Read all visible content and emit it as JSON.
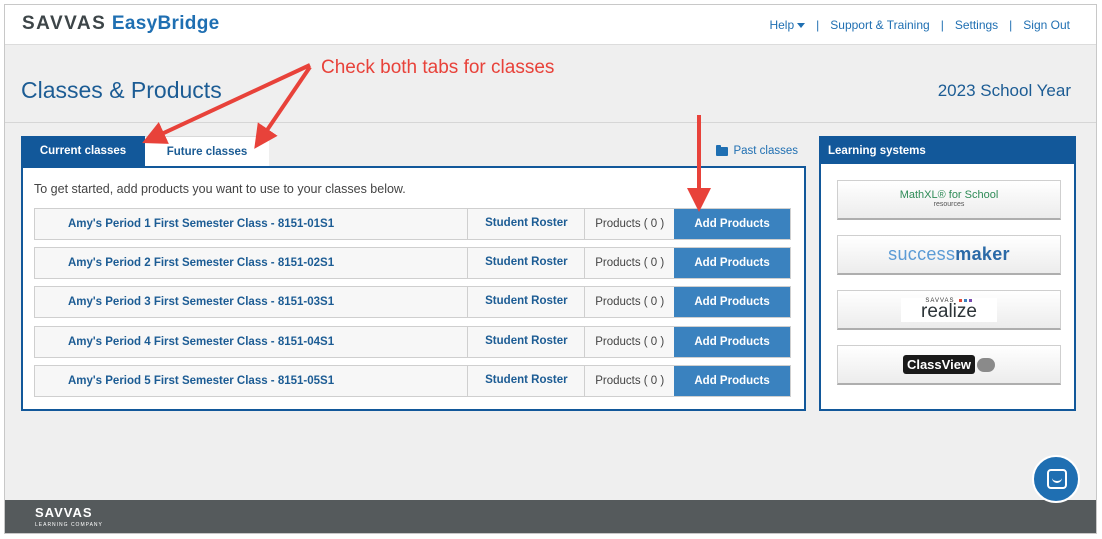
{
  "brand": {
    "name_part1": "SAVVAS",
    "name_part2": "EasyBridge"
  },
  "top_nav": [
    {
      "label": "Help"
    },
    {
      "label": "Support & Training"
    },
    {
      "label": "Settings"
    },
    {
      "label": "Sign Out"
    }
  ],
  "page": {
    "title": "Classes & Products",
    "school_year": "2023 School Year"
  },
  "annotation": {
    "text": "Check both tabs for classes",
    "color": "#e8423a"
  },
  "tabs": [
    {
      "label": "Current classes",
      "active": true
    },
    {
      "label": "Future classes",
      "active": false
    }
  ],
  "past_classes": {
    "label": "Past classes"
  },
  "instructions": "To get started, add products you want to use to your classes below.",
  "classes": [
    {
      "name": "Amy's Period 1 First Semester Class - 8151-01S1",
      "roster": "Student Roster",
      "products": "Products ( 0 )",
      "action": "Add Products"
    },
    {
      "name": "Amy's Period 2 First Semester Class - 8151-02S1",
      "roster": "Student Roster",
      "products": "Products ( 0 )",
      "action": "Add Products"
    },
    {
      "name": "Amy's Period 3 First Semester Class - 8151-03S1",
      "roster": "Student Roster",
      "products": "Products ( 0 )",
      "action": "Add Products"
    },
    {
      "name": "Amy's Period 4 First Semester Class - 8151-04S1",
      "roster": "Student Roster",
      "products": "Products ( 0 )",
      "action": "Add Products"
    },
    {
      "name": "Amy's Period 5 First Semester Class - 8151-05S1",
      "roster": "Student Roster",
      "products": "Products ( 0 )",
      "action": "Add Products"
    }
  ],
  "learning_systems": {
    "header": "Learning systems",
    "mathxl": {
      "name": "MathXL® for School",
      "sub": "resources"
    },
    "successmaker": {
      "part1": "success",
      "part2": "maker"
    },
    "realize": {
      "small": "SAVVAS",
      "name": "realize"
    },
    "classview": {
      "name": "ClassView"
    }
  },
  "footer": {
    "logo": "SAVVAS",
    "sub": "LEARNING COMPANY"
  },
  "colors": {
    "primary": "#12589a",
    "button": "#3a82bf",
    "link": "#1f6fb2",
    "annotation": "#e8423a"
  },
  "icons": {
    "chat": "chat-bubble-icon",
    "folder": "folder-open-icon",
    "caret": "caret-down-icon"
  }
}
